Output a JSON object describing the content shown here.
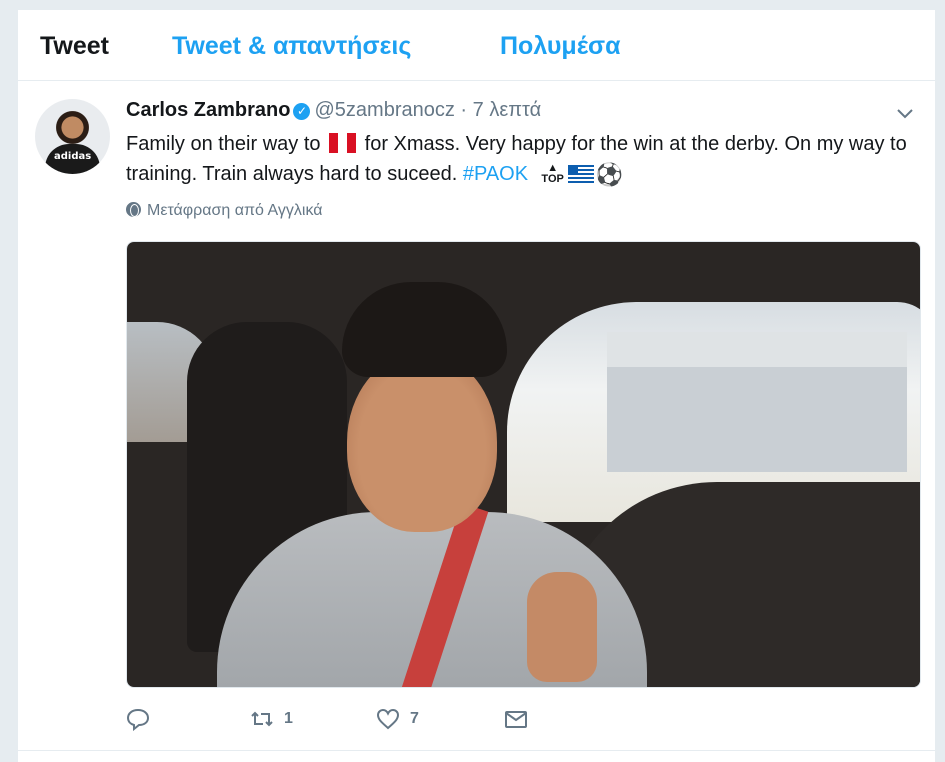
{
  "tabs": [
    {
      "label": "Tweet",
      "active": true
    },
    {
      "label": "Tweet & απαντήσεις",
      "active": false
    },
    {
      "label": "Πολυμέσα",
      "active": false
    }
  ],
  "tweet": {
    "author_name": "Carlos Zambrano",
    "verified": true,
    "handle": "@5zambranocz",
    "separator": "·",
    "time": "7 λεπτά",
    "text_part1": "Family on their way to",
    "text_part2": "for Xmass. Very happy for the win at the derby. On my way to training. Train always hard to suceed.",
    "hashtag": "#PAOK",
    "top_label": "TOP",
    "emoji_ball": "⚽",
    "translate_label": "Μετάφραση από Αγγλικά",
    "replies": "",
    "retweets": "1",
    "likes": "7",
    "avatar_logo_text": "adidas"
  },
  "colors": {
    "accent": "#1da1f2",
    "muted": "#657786",
    "text": "#14171a",
    "background": "#e6ecf0"
  },
  "icons": [
    "verified-badge-icon",
    "chevron-down-icon",
    "globe-icon",
    "flag-peru-icon",
    "top-arrow-icon",
    "flag-greece-icon",
    "soccer-ball-icon",
    "reply-icon",
    "retweet-icon",
    "like-icon",
    "direct-message-icon"
  ]
}
